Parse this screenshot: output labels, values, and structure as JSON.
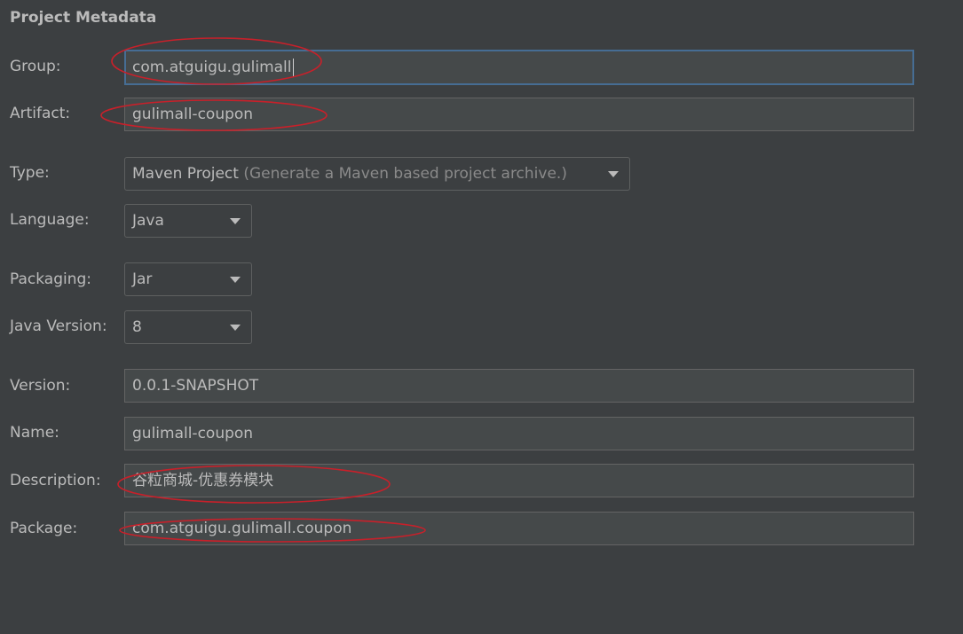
{
  "section_title": "Project Metadata",
  "fields": {
    "group": {
      "label": "Group:",
      "value": "com.atguigu.gulimall"
    },
    "artifact": {
      "label": "Artifact:",
      "value": "gulimall-coupon"
    },
    "type": {
      "label": "Type:",
      "value": "Maven Project",
      "hint": "(Generate a Maven based project archive.)"
    },
    "language": {
      "label": "Language:",
      "value": "Java"
    },
    "packaging": {
      "label": "Packaging:",
      "value": "Jar"
    },
    "java_version": {
      "label": "Java Version:",
      "value": "8"
    },
    "version": {
      "label": "Version:",
      "value": "0.0.1-SNAPSHOT"
    },
    "name": {
      "label": "Name:",
      "value": "gulimall-coupon"
    },
    "description": {
      "label": "Description:",
      "value": "谷粒商城-优惠券模块"
    },
    "package": {
      "label": "Package:",
      "value": "com.atguigu.gulimall.coupon"
    }
  },
  "colors": {
    "background": "#3c3f41",
    "field_bg": "#45494a",
    "focus_border": "#466d94",
    "annotation": "#c8202a"
  }
}
